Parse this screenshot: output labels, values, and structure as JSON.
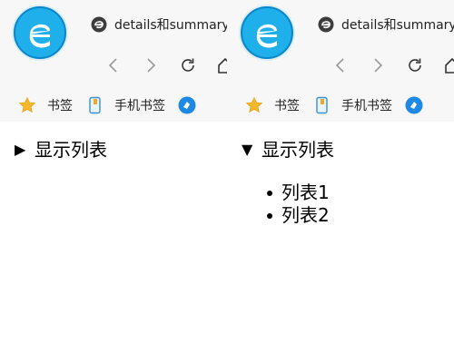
{
  "panes": [
    {
      "tab": {
        "title": "details和summary",
        "icon": "edge-icon"
      },
      "nav": {
        "back_icon": "back-icon",
        "forward_icon": "forward-icon",
        "refresh_icon": "refresh-icon",
        "home_icon": "home-icon"
      },
      "bookmarks": [
        {
          "label": "书签",
          "icon": "star-icon"
        },
        {
          "label": "手机书签",
          "icon": "phone-bookmark-icon"
        }
      ],
      "details": {
        "open": false,
        "marker": "▶",
        "summary": "显示列表",
        "items": []
      }
    },
    {
      "tab": {
        "title": "details和summary",
        "icon": "edge-icon"
      },
      "nav": {
        "back_icon": "back-icon",
        "forward_icon": "forward-icon",
        "refresh_icon": "refresh-icon",
        "home_icon": "home-icon"
      },
      "bookmarks": [
        {
          "label": "书签",
          "icon": "star-icon"
        },
        {
          "label": "手机书签",
          "icon": "phone-bookmark-icon"
        }
      ],
      "details": {
        "open": true,
        "marker": "▼",
        "summary": "显示列表",
        "items": [
          "列表1",
          "列表2"
        ]
      }
    }
  ],
  "colors": {
    "logo_blue": "#1fb0ec",
    "logo_dark": "#0b86c8",
    "star": "#f5b72a",
    "toolbar_bg": "#f7f7f7"
  }
}
